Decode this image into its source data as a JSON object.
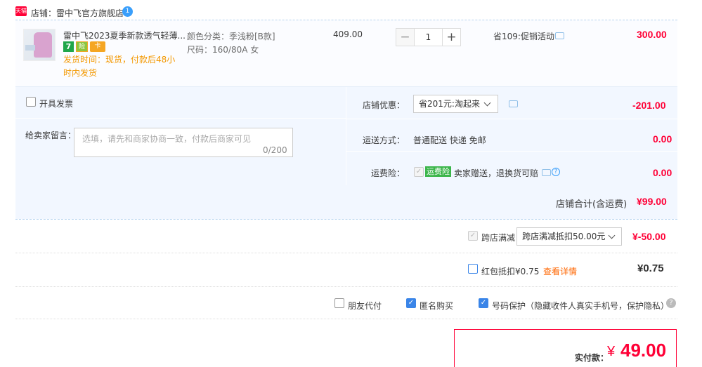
{
  "shop": {
    "badge": "天猫",
    "label": "店铺：雷中飞官方旗舰店",
    "chat_icon": "wangwang-icon",
    "chat_badge": "1"
  },
  "item": {
    "title": "雷中飞2023夏季新款透气轻薄...",
    "badges": [
      "7",
      "险",
      "卡"
    ],
    "shipping_note": "发货时间：现货，付款后48小时内发货",
    "sku_color": "颜色分类：季浅粉[B款]",
    "sku_size": "尺码：160/80A 女",
    "unit_price": "409.00",
    "qty_minus": "−",
    "qty": "1",
    "qty_plus": "+",
    "promo": "省109:促销活动",
    "subtotal": "300.00"
  },
  "invoice": {
    "label": "开具发票"
  },
  "message": {
    "label": "给卖家留言：",
    "placeholder": "选填，请先和商家协商一致，付款后商家可见",
    "count": "0/200"
  },
  "shop_discount": {
    "label": "店铺优惠：",
    "selected": "省201元:淘起来",
    "value": "-201.00"
  },
  "delivery": {
    "label": "运送方式：",
    "value": "普通配送 快递 免邮",
    "amount": "0.00"
  },
  "insurance": {
    "label": "运费险：",
    "badge": "运费险",
    "text": "卖家赠送，退换货可赔",
    "amount": "0.00"
  },
  "shop_total": {
    "label": "店铺合计(含运费)",
    "value": "¥99.00"
  },
  "cross_store": {
    "label": "跨店满减",
    "selected": "跨店满减抵扣50.00元",
    "value": "¥-50.00"
  },
  "red_packet": {
    "label": "红包抵扣¥0.75",
    "link": "查看详情",
    "value": "¥0.75"
  },
  "options": {
    "friend_pay": "朋友代付",
    "anonymous": "匿名购买",
    "phone_protect": "号码保护（隐藏收件人真实手机号，保护隐私）",
    "help": "?"
  },
  "payment": {
    "label": "实付款：",
    "currency": "¥",
    "amount": "49.00"
  },
  "colors": {
    "accent": "#ff0036",
    "panel": "#f2f7ff",
    "link_orange": "#ff6600",
    "check_blue": "#3a85e8"
  }
}
